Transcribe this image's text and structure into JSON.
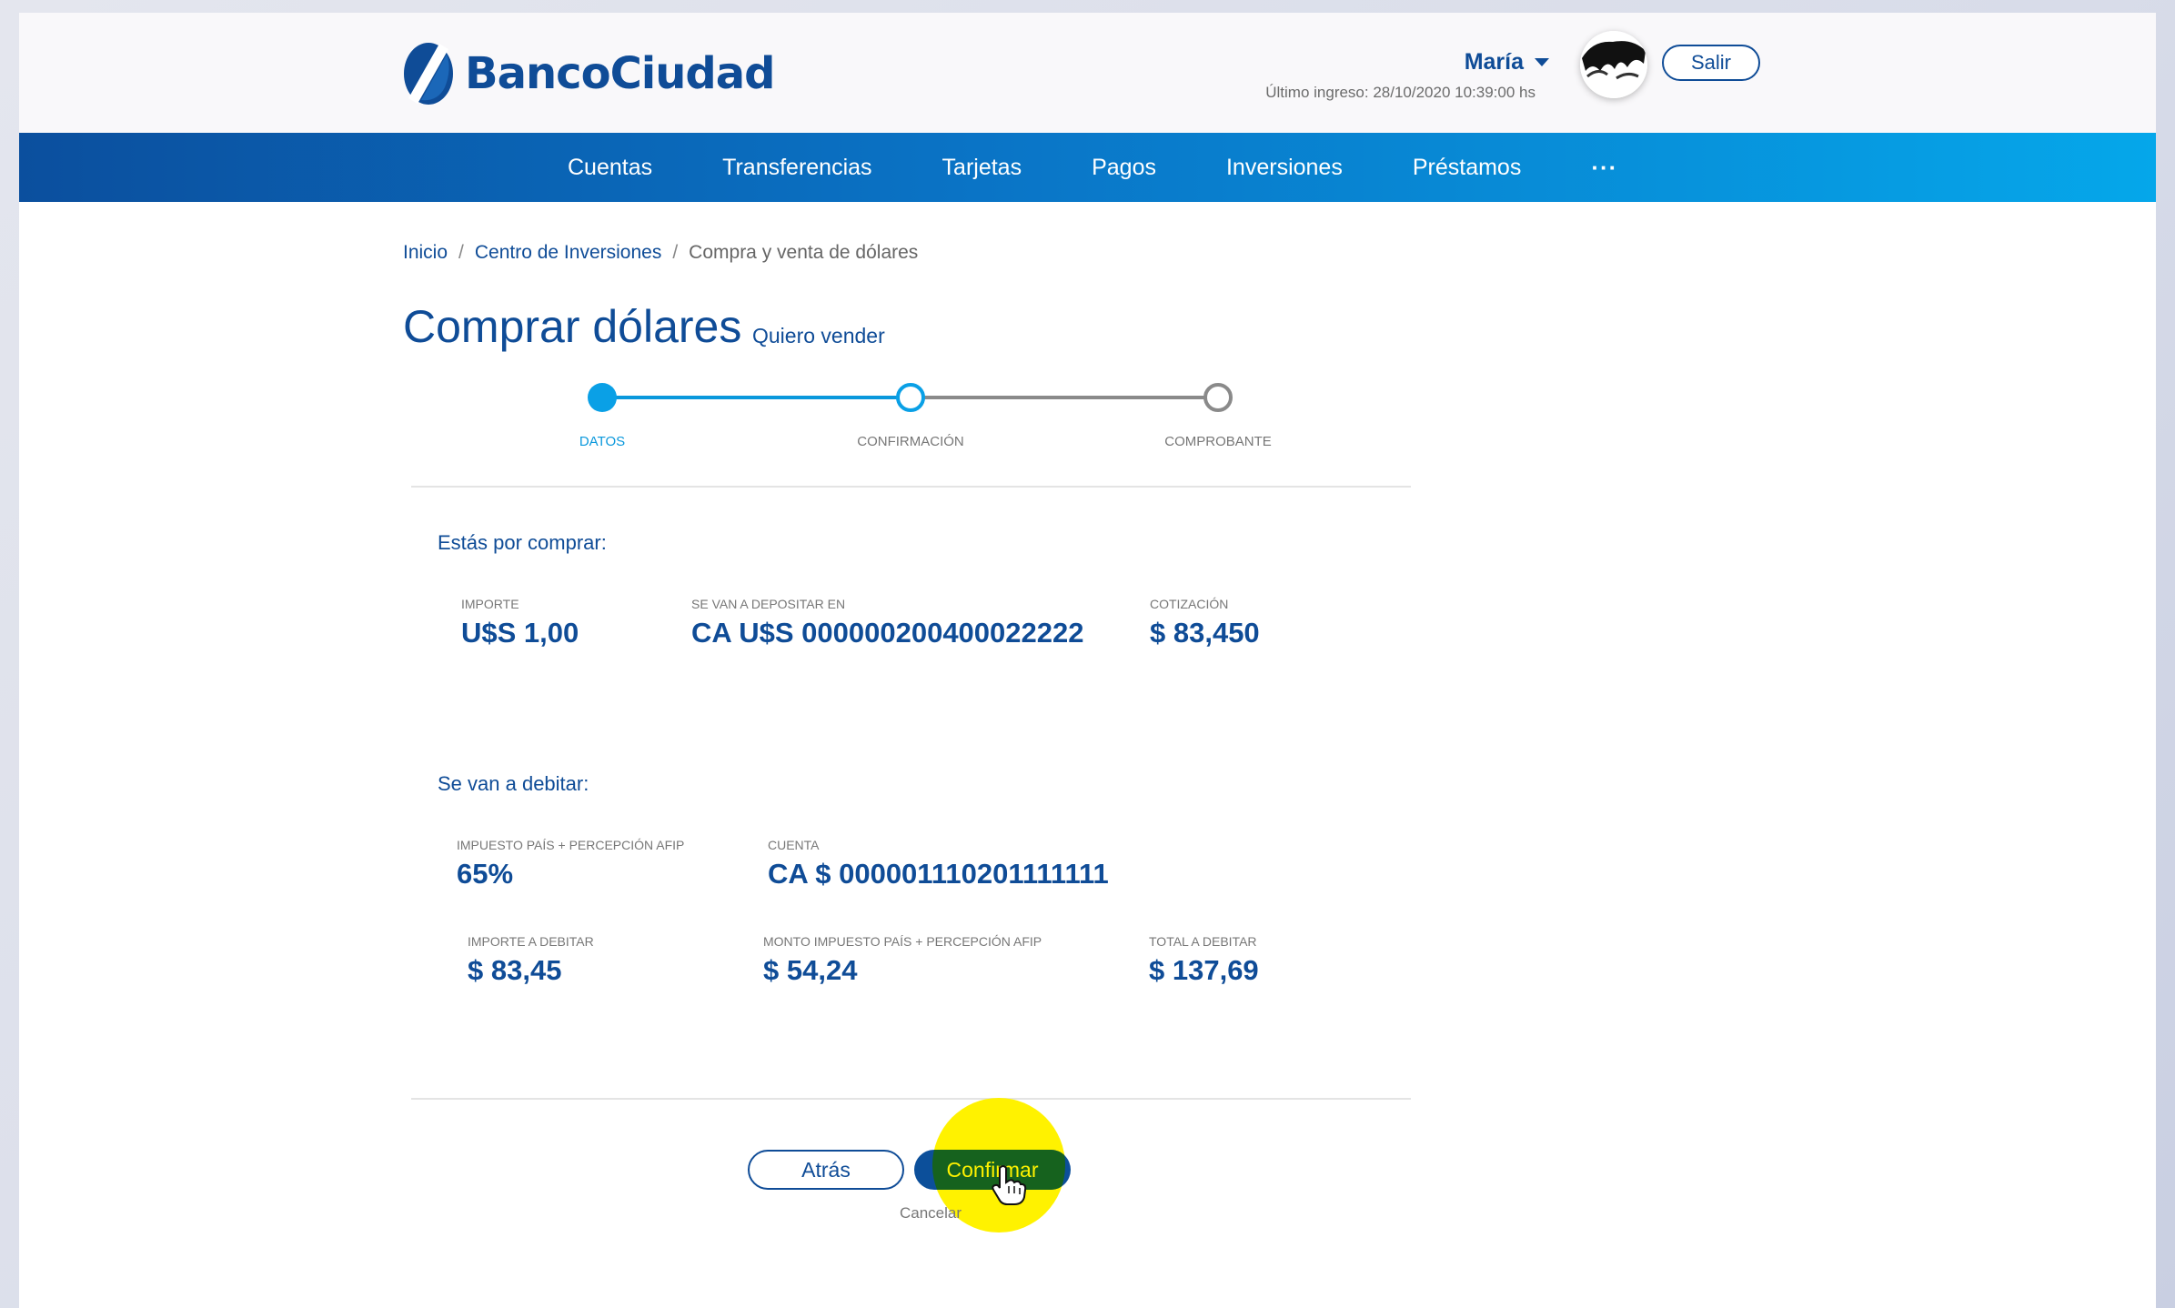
{
  "header": {
    "brand": "BancoCiudad",
    "user_name": "María",
    "last_login": "Último ingreso: 28/10/2020 10:39:00 hs",
    "logout_label": "Salir"
  },
  "nav": {
    "items": [
      "Cuentas",
      "Transferencias",
      "Tarjetas",
      "Pagos",
      "Inversiones",
      "Préstamos"
    ],
    "more_label": "···"
  },
  "breadcrumb": {
    "items": [
      "Inicio",
      "Centro de Inversiones",
      "Compra y venta de dólares"
    ],
    "separator": "/"
  },
  "page": {
    "title": "Comprar dólares",
    "alt_action": "Quiero vender"
  },
  "stepper": {
    "steps": [
      "DATOS",
      "CONFIRMACIÓN",
      "COMPROBANTE"
    ],
    "current_index": 1
  },
  "purchase": {
    "title": "Estás por comprar:",
    "fields": [
      {
        "label": "IMPORTE",
        "value": "U$S 1,00"
      },
      {
        "label": "SE VAN A DEPOSITAR EN",
        "value": "CA U$S 000000200400022222"
      },
      {
        "label": "COTIZACIÓN",
        "value": "$ 83,450"
      }
    ]
  },
  "debit": {
    "title": "Se van a debitar:",
    "fields": [
      {
        "label": "IMPUESTO PAÍS + PERCEPCIÓN AFIP",
        "value": "65%"
      },
      {
        "label": "CUENTA",
        "value": "CA $ 000001110201111111"
      },
      {
        "label": "IMPORTE A DEBITAR",
        "value": "$ 83,45"
      },
      {
        "label": "MONTO IMPUESTO PAÍS + PERCEPCIÓN AFIP",
        "value": "$ 54,24"
      },
      {
        "label": "TOTAL A DEBITAR",
        "value": "$ 137,69"
      }
    ]
  },
  "actions": {
    "back": "Atrás",
    "confirm": "Confirmar",
    "cancel": "Cancelar"
  },
  "colors": {
    "brand": "#0f4c97",
    "accent": "#0aa0e6",
    "click_highlight": "#fff200"
  }
}
